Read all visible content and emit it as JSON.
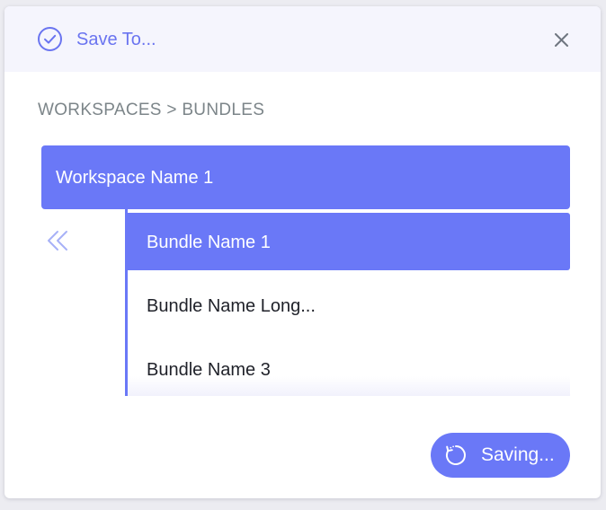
{
  "dialog": {
    "title": "Save To...",
    "icons": {
      "title": "check-circle-icon",
      "close": "close-icon"
    }
  },
  "breadcrumb": {
    "text": "WORKSPACES > BUNDLES"
  },
  "workspace": {
    "label": "Workspace Name 1"
  },
  "navigation": {
    "back_icon": "double-chevron-left-icon"
  },
  "bundles": [
    {
      "label": "Bundle Name 1",
      "selected": true
    },
    {
      "label": "Bundle Name Long...",
      "selected": false
    },
    {
      "label": "Bundle Name 3",
      "selected": false
    }
  ],
  "action": {
    "label": "Saving...",
    "icon": "loading-spinner-icon"
  },
  "colors": {
    "accent": "#6a78f7",
    "title_text": "#6a74f0",
    "header_bg": "#f5f5fd",
    "breadcrumb_text": "#7c8589",
    "item_text": "#1f2129"
  }
}
